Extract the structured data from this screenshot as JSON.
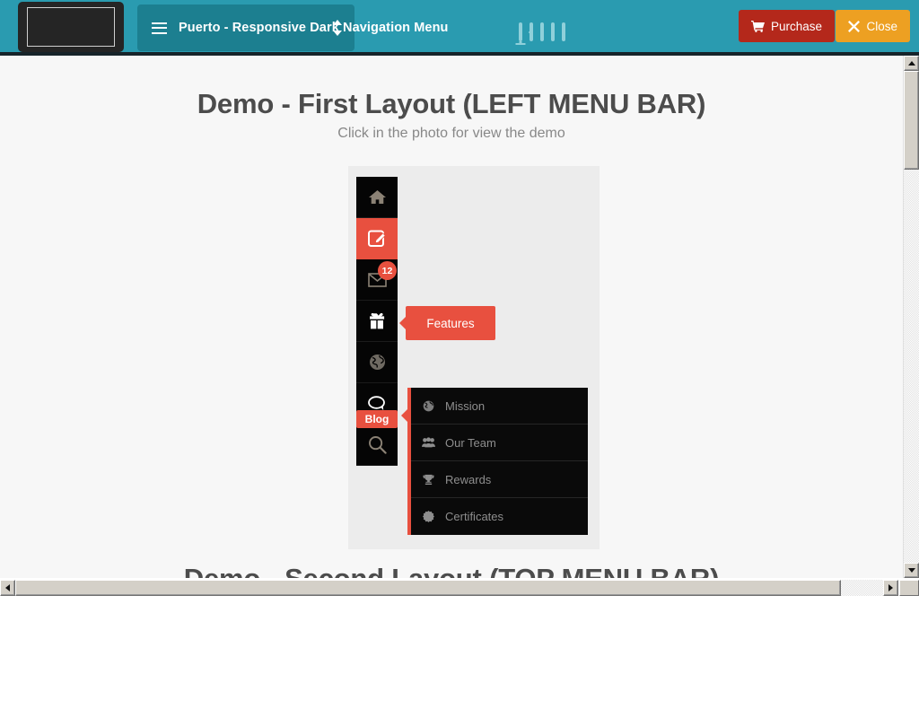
{
  "topbar": {
    "background_color": "#2a9bb0",
    "logo": {
      "name": "logo-placeholder"
    },
    "selector": {
      "menu_icon": "hamburger-icon",
      "title": "Puerto - Responsive Dark Navigation Menu",
      "arrows_icon": "sort-updown-icon"
    },
    "devices": [
      {
        "name": "desktop",
        "icon": "desktop-icon"
      },
      {
        "name": "tablet-landscape",
        "icon": "tablet-landscape-icon"
      },
      {
        "name": "tablet-portrait",
        "icon": "tablet-portrait-icon"
      },
      {
        "name": "mobile-landscape",
        "icon": "mobile-landscape-icon"
      },
      {
        "name": "mobile-portrait",
        "icon": "mobile-portrait-icon"
      }
    ],
    "purchase_button": {
      "label": "Purchase",
      "icon": "cart-icon",
      "color": "#b4281b"
    },
    "close_button": {
      "label": "Close",
      "icon": "times-icon",
      "color": "#eda022"
    }
  },
  "content": {
    "title": "Demo - First Layout (LEFT MENU BAR)",
    "subtitle": "Click in the photo for view the demo",
    "next_title": "Demo - Second Layout (TOP MENU BAR)",
    "accent_color": "#e8503f",
    "demo": {
      "icon_items": [
        {
          "name": "home",
          "icon": "home-icon",
          "active": false,
          "badge": ""
        },
        {
          "name": "pages",
          "icon": "pencil-square-icon",
          "active": true,
          "badge": ""
        },
        {
          "name": "messages",
          "icon": "envelope-icon",
          "active": false,
          "badge": "12"
        },
        {
          "name": "features",
          "icon": "gift-icon",
          "active": false,
          "badge": ""
        },
        {
          "name": "about",
          "icon": "globe-icon",
          "active": false,
          "badge": ""
        },
        {
          "name": "blog",
          "icon": "comment-icon",
          "active": false,
          "badge": ""
        },
        {
          "name": "search",
          "icon": "search-icon",
          "active": false,
          "badge": ""
        }
      ],
      "tooltip_features": "Features",
      "tooltip_blog": "Blog",
      "submenu": [
        {
          "label": "Mission",
          "icon": "globe-icon"
        },
        {
          "label": "Our Team",
          "icon": "users-icon"
        },
        {
          "label": "Rewards",
          "icon": "trophy-icon"
        },
        {
          "label": "Certificates",
          "icon": "certificate-icon"
        }
      ]
    }
  },
  "scrollbars": {
    "vertical": {
      "up_icon": "triangle-up-icon",
      "down_icon": "triangle-down-icon"
    },
    "horizontal": {
      "left_icon": "triangle-left-icon",
      "right_icon": "triangle-right-icon"
    }
  }
}
